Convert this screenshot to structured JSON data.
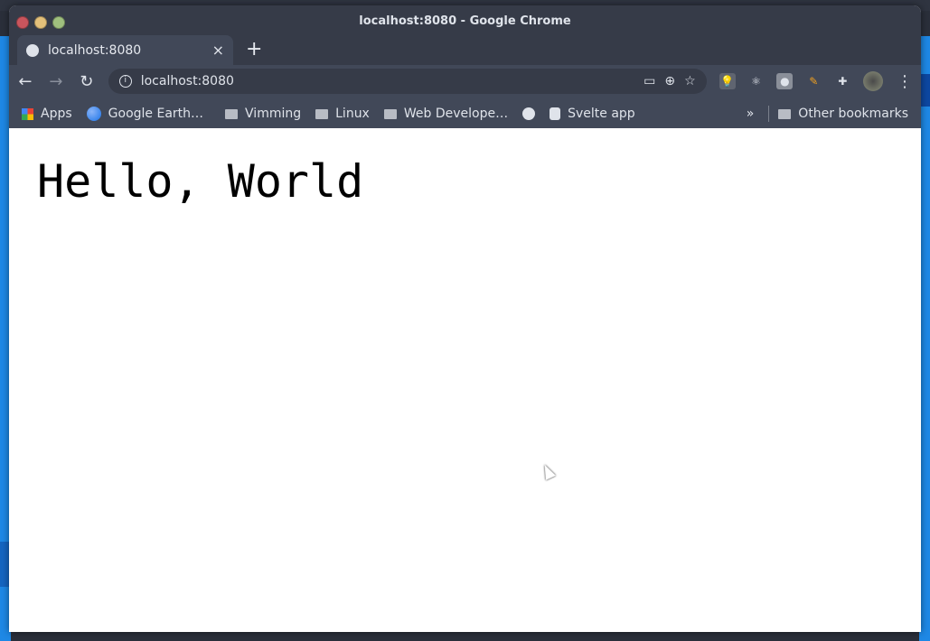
{
  "window": {
    "title": "localhost:8080 - Google Chrome"
  },
  "tab": {
    "label": "localhost:8080",
    "close": "×",
    "new_tab": "+"
  },
  "toolbar": {
    "url": "localhost:8080",
    "back": "←",
    "forward": "→",
    "reload": "↻",
    "menu": "⋮"
  },
  "bookmarks": {
    "items": [
      {
        "label": "Apps",
        "icon": "apps-grid-icon"
      },
      {
        "label": "Google Earth…",
        "icon": "google-earth-icon"
      },
      {
        "label": "Vimming",
        "icon": "folder-icon"
      },
      {
        "label": "Linux",
        "icon": "folder-icon"
      },
      {
        "label": "Web Develope…",
        "icon": "folder-icon"
      },
      {
        "label": "",
        "icon": "globe-icon"
      },
      {
        "label": "Svelte app",
        "icon": "svelte-icon"
      }
    ],
    "overflow": "»",
    "other": "Other bookmarks"
  },
  "page": {
    "heading": "Hello, World"
  },
  "colors": {
    "frame": "#363b48",
    "toolbar": "#414858",
    "text": "#dfe3ea"
  }
}
